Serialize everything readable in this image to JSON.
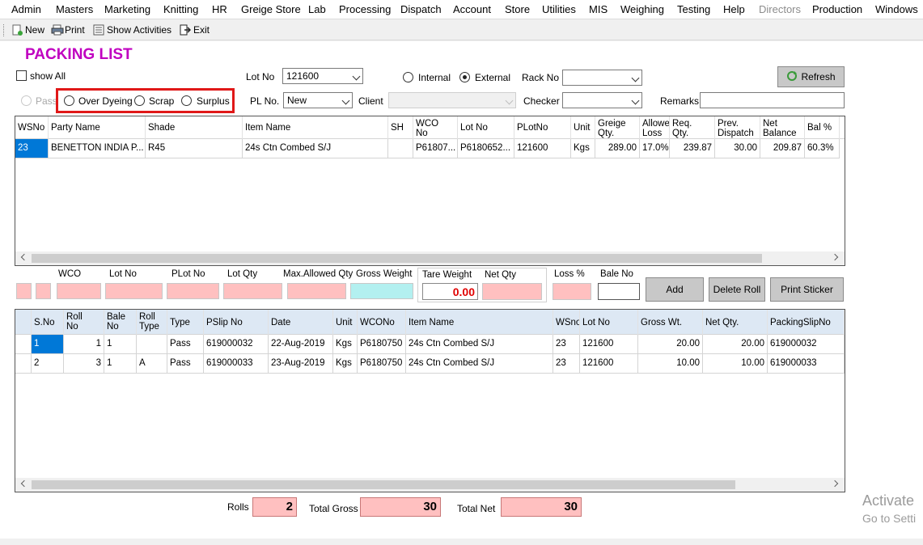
{
  "menu": [
    "Admin",
    "Masters",
    "Marketing",
    "Knitting",
    "HR",
    "Greige Store",
    "Lab",
    "Processing",
    "Dispatch",
    "Account",
    "Store",
    "Utilities",
    "MIS",
    "Weighing",
    "Testing",
    "Help",
    "Directors",
    "Production",
    "Windows"
  ],
  "toolbar": {
    "new": "New",
    "print": "Print",
    "show_activities": "Show Activities",
    "exit": "Exit"
  },
  "page_title": "PACKING LIST",
  "filters": {
    "show_all": "show All",
    "lot_no_label": "Lot No",
    "lot_no_value": "121600",
    "internal": "Internal",
    "external": "External",
    "rack_no_label": "Rack No",
    "refresh": "Refresh",
    "pass": "Pass",
    "over_dyeing": "Over Dyeing",
    "scrap": "Scrap",
    "surplus": "Surplus",
    "pl_no_label": "PL No.",
    "pl_no_value": "New",
    "client_label": "Client",
    "checker_label": "Checker",
    "remarks_label": "Remarks"
  },
  "top_grid": {
    "headers": [
      "WSNo",
      "Party Name",
      "Shade",
      "Item Name",
      "SH",
      "WCO\nNo",
      "Lot No",
      "PLotNo",
      "Unit",
      "Greige\nQty.",
      "Allowe\nLoss",
      "Req.\nQty.",
      "Prev.\nDispatch",
      "Net\nBalance",
      "Bal %"
    ],
    "rows": [
      [
        "23",
        "BENETTON INDIA P...",
        "R45",
        "24s Ctn Combed S/J",
        "",
        "P61807...",
        "P6180652...",
        "121600",
        "Kgs",
        "289.00",
        "17.0%",
        "239.87",
        "30.00",
        "209.87",
        "60.3%"
      ]
    ]
  },
  "entry": {
    "wco": "WCO",
    "lot_no": "Lot No",
    "plot_no": "PLot No",
    "lot_qty": "Lot Qty",
    "max_allowed_qty": "Max.Allowed Qty",
    "gross_weight": "Gross Weight",
    "tare_weight": "Tare Weight",
    "tare_value": "0.00",
    "net_qty": "Net Qty",
    "loss_pct": "Loss %",
    "bale_no": "Bale No",
    "add": "Add",
    "delete_roll": "Delete Roll",
    "print_sticker": "Print Sticker"
  },
  "bottom_grid": {
    "headers": [
      "S.No",
      "Roll\nNo",
      "Bale\nNo",
      "Roll\nType",
      "Type",
      "PSlip No",
      "Date",
      "Unit",
      "WCONo",
      "Item Name",
      "WSno",
      "Lot No",
      "Gross Wt.",
      "Net Qty.",
      "PackingSlipNo"
    ],
    "rows": [
      [
        "1",
        "1",
        "1",
        "",
        "Pass",
        "619000032",
        "22-Aug-2019",
        "Kgs",
        "P6180750",
        "24s Ctn Combed S/J",
        "23",
        "121600",
        "20.00",
        "20.00",
        "619000032"
      ],
      [
        "2",
        "3",
        "1",
        "A",
        "Pass",
        "619000033",
        "23-Aug-2019",
        "Kgs",
        "P6180750",
        "24s Ctn Combed S/J",
        "23",
        "121600",
        "10.00",
        "10.00",
        "619000033"
      ]
    ]
  },
  "totals": {
    "rolls_label": "Rolls",
    "rolls": "2",
    "gross_label": "Total Gross",
    "gross": "30",
    "net_label": "Total Net",
    "net": "30"
  },
  "watermark": {
    "line1": "Activate",
    "line2": "Go to Setti"
  }
}
